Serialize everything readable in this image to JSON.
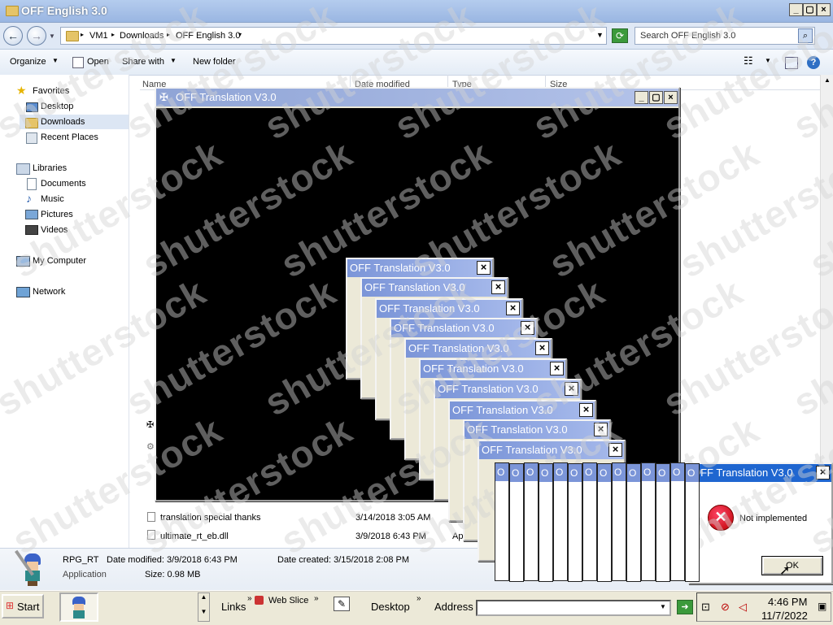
{
  "window": {
    "title": "OFF English 3.0"
  },
  "address": {
    "crumbs": [
      "VM1",
      "Downloads",
      "OFF English 3.0"
    ],
    "search_placeholder": "Search OFF English 3.0"
  },
  "toolbar": {
    "organize": "Organize",
    "open": "Open",
    "share": "Share with",
    "new_folder": "New folder"
  },
  "nav": {
    "favorites": "Favorites",
    "desktop": "Desktop",
    "downloads": "Downloads",
    "recent": "Recent Places",
    "libraries": "Libraries",
    "documents": "Documents",
    "music": "Music",
    "pictures": "Pictures",
    "videos": "Videos",
    "computer": "My Computer",
    "network": "Network"
  },
  "columns": {
    "name": "Name",
    "date": "Date modified",
    "type": "Type",
    "size": "Size"
  },
  "files": [
    {
      "name": "translation special thanks",
      "date": "3/14/2018 3:05 AM",
      "type": ""
    },
    {
      "name": "ultimate_rt_eb.dll",
      "date": "3/9/2018 6:43 PM",
      "type": "Ap"
    }
  ],
  "details": {
    "name": "RPG_RT",
    "type": "Application",
    "modified": "Date modified: 3/9/2018 6:43 PM",
    "created": "Date created: 3/15/2018 2:08 PM",
    "size": "Size: 0.98 MB"
  },
  "game_window": {
    "title": "OFF Translation V3.0"
  },
  "dialog_stack_title": "OFF Translation V3.0",
  "dialog_stub_letter": "O",
  "error_dialog": {
    "title": "OFF Translation V3.0",
    "message": "Not implemented",
    "ok": "OK"
  },
  "taskbar": {
    "start": "Start",
    "links": "Links",
    "web_slice": "Web Slice",
    "desktop": "Desktop",
    "address": "Address",
    "time": "4:46 PM",
    "date": "11/7/2022"
  },
  "watermark": "shutterstock"
}
